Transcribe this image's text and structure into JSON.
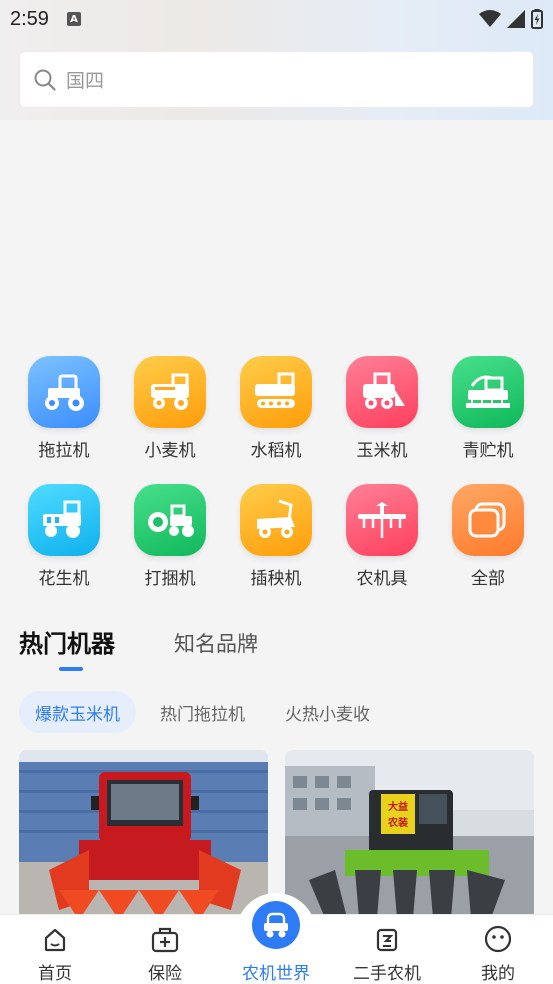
{
  "status": {
    "time": "2:59",
    "notification_icon": "A"
  },
  "search": {
    "placeholder": "国四"
  },
  "categories": [
    {
      "label": "拖拉机",
      "icon": "tractor-icon",
      "color": "#4da3ff"
    },
    {
      "label": "小麦机",
      "icon": "wheat-harvester-icon",
      "color": "#ffb21f"
    },
    {
      "label": "水稻机",
      "icon": "rice-harvester-icon",
      "color": "#ffb21f"
    },
    {
      "label": "玉米机",
      "icon": "corn-harvester-icon",
      "color": "#ff5670"
    },
    {
      "label": "青贮机",
      "icon": "silage-harvester-icon",
      "color": "#21c96b"
    },
    {
      "label": "花生机",
      "icon": "peanut-harvester-icon",
      "color": "#1cc3f2"
    },
    {
      "label": "打捆机",
      "icon": "baler-icon",
      "color": "#21c96b"
    },
    {
      "label": "插秧机",
      "icon": "rice-transplanter-icon",
      "color": "#ffb21f"
    },
    {
      "label": "农机具",
      "icon": "implement-icon",
      "color": "#ff5670"
    },
    {
      "label": "全部",
      "icon": "all-icon",
      "color": "#ff8a3d"
    }
  ],
  "section_tabs": {
    "active": "热门机器",
    "other": "知名品牌"
  },
  "chips": [
    "爆款玉米机",
    "热门拖拉机",
    "火热小麦收"
  ],
  "product_cards": [
    {
      "image": "red-corn-harvester-photo"
    },
    {
      "image": "green-corn-harvester-photo",
      "sign_text": "大益农装"
    }
  ],
  "nav": [
    {
      "label": "首页",
      "icon": "home-icon"
    },
    {
      "label": "保险",
      "icon": "insurance-icon"
    },
    {
      "label": "农机世界",
      "icon": "tractor-world-icon",
      "active": true
    },
    {
      "label": "二手农机",
      "icon": "secondhand-icon"
    },
    {
      "label": "我的",
      "icon": "profile-icon"
    }
  ],
  "colors": {
    "accent": "#2d7cf6"
  }
}
